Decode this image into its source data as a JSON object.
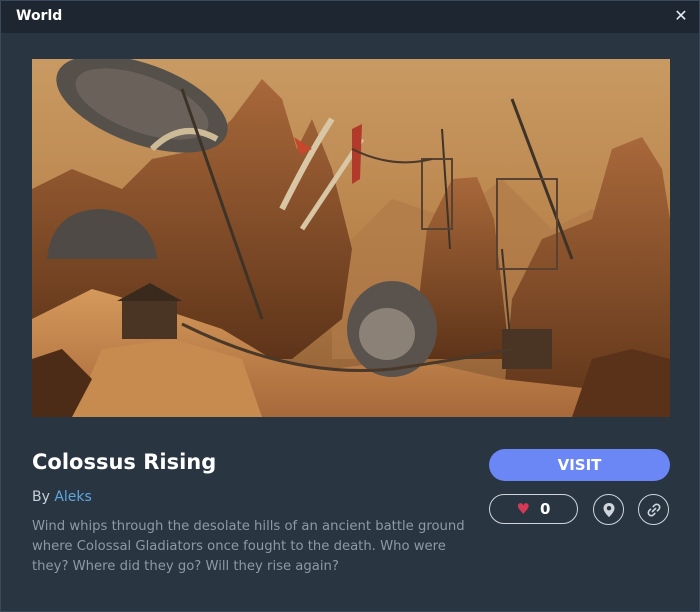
{
  "window": {
    "title": "World"
  },
  "world": {
    "name": "Colossus Rising",
    "by_label": "By",
    "author": "Aleks",
    "description": "Wind whips through the desolate hills of an ancient battle ground where Colossal Gladiators once fought to the death. Who were they? Where did they go? Will they rise again?"
  },
  "actions": {
    "visit_label": "VISIT",
    "like_count": "0"
  },
  "icons": {
    "close": "close-icon",
    "heart": "heart-icon",
    "location": "location-pin-icon",
    "link": "link-icon"
  },
  "colors": {
    "accent": "#6b86f5",
    "author_link": "#5ea6e0",
    "heart": "#d43a55",
    "panel": "#293541",
    "titlebar": "#1e2731"
  }
}
